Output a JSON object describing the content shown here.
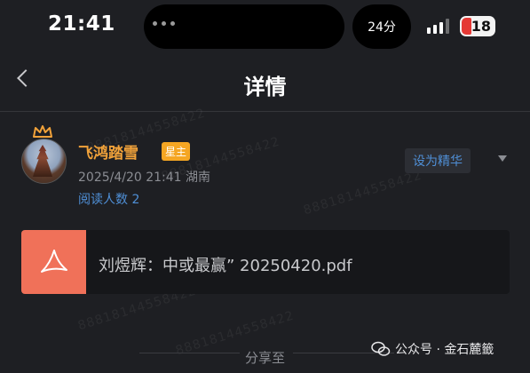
{
  "status_bar": {
    "time": "21:41",
    "timer_label": "24分",
    "battery_level": "18"
  },
  "nav": {
    "title": "详情"
  },
  "post": {
    "username": "飞鸿踏雪",
    "role_badge": "星主",
    "meta": "2025/4/20 21:41  湖南",
    "read_count": "阅读人数 2",
    "action_label": "设为精华"
  },
  "attachment": {
    "file_name": "刘煜辉：中或最赢” 20250420.pdf"
  },
  "share": {
    "label": "分享至"
  },
  "watermark": {
    "source": "公众号 · 金石麓籤",
    "code": "88818144558422"
  },
  "colors": {
    "background": "#1e1f23",
    "username": "#f1a23a",
    "badge": "#f5a623",
    "link_blue": "#4f8fd6",
    "pdf_icon": "#f07159"
  }
}
